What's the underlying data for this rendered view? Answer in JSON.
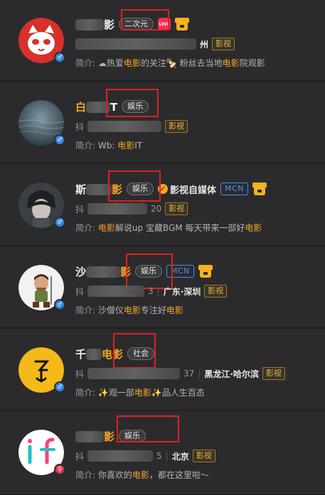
{
  "cards": [
    {
      "name_prefix": "",
      "name_suffix": "影",
      "category": "二次元",
      "meta_prefix": "",
      "meta_suffix": "州",
      "location": "",
      "tag": "影视",
      "bio_label": "简介:",
      "bio_parts": [
        "☁热爱",
        "电影",
        "的关注🍢 粉丝去当地",
        "电影",
        "院观影"
      ],
      "gender": "male"
    },
    {
      "name_prefix": "白",
      "name_suffix": "T",
      "category": "娱乐",
      "meta_prefix": "抖",
      "meta_suffix": "",
      "location": "",
      "tag": "影视",
      "bio_label": "简介:",
      "bio_parts": [
        "Wb: ",
        "电影",
        "IT"
      ],
      "gender": "male"
    },
    {
      "name_prefix": "斯",
      "name_suffix": "影",
      "category": "娱乐",
      "verified_text": "影视自媒体",
      "mcn": "MCN",
      "meta_prefix": "抖",
      "meta_suffix": "20",
      "location": "",
      "tag": "影视",
      "bio_label": "简介:",
      "bio_parts": [
        "电影",
        "解说up 宝藏BGM 每天带来一部好",
        "电影"
      ],
      "gender": "male"
    },
    {
      "name_prefix": "沙",
      "name_suffix": "影",
      "category": "娱乐",
      "mcn": "MCN",
      "meta_prefix": "抖",
      "meta_suffix": "3",
      "location": "广东·深圳",
      "tag": "影视",
      "bio_label": "简介:",
      "bio_parts": [
        "沙僧仪",
        "电影",
        "专注好",
        "电影"
      ],
      "gender": "male"
    },
    {
      "name_prefix": "千",
      "name_suffix": "电影",
      "category": "社会",
      "meta_prefix": "抖",
      "meta_suffix": "37",
      "location": "黑龙江·哈尔滨",
      "tag": "影视",
      "bio_label": "简介:",
      "bio_parts": [
        "✨观一部",
        "电影",
        "✨品人生百态"
      ],
      "gender": "male"
    },
    {
      "name_prefix": "",
      "name_suffix": "影",
      "category": "娱乐",
      "meta_prefix": "抖",
      "meta_suffix": "5",
      "location": "北京",
      "tag": "影视",
      "bio_label": "简介:",
      "bio_parts": [
        "你喜欢的",
        "电影",
        "，都在这里啦～"
      ],
      "gender": "female"
    }
  ],
  "icons": {
    "live_text": "LIVE",
    "gender_male": "♂",
    "gender_female": "♀",
    "verified": "✓"
  },
  "colors": {
    "background": "#262628",
    "highlight": "#f5a623",
    "annotation_box": "#e02020",
    "mcn_blue": "#4d8ff0"
  }
}
